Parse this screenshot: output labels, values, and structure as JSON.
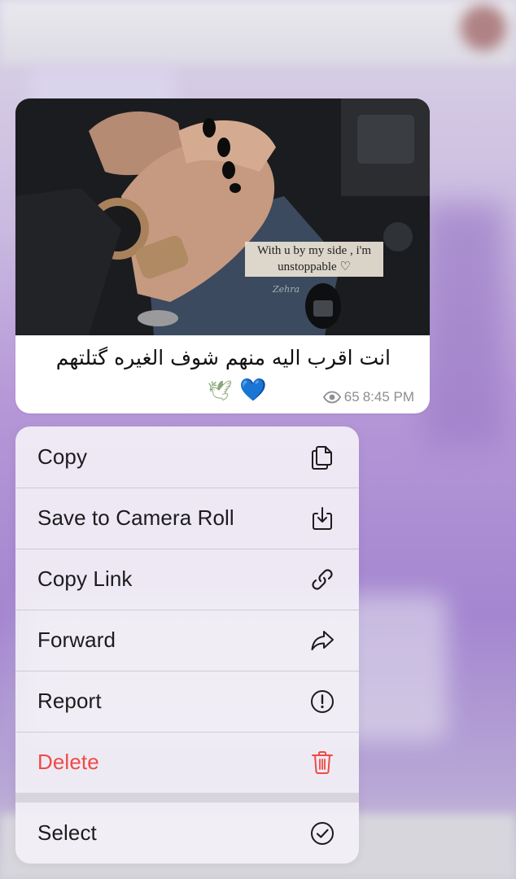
{
  "message": {
    "photo_quote_line1": "With u by my side , i'm",
    "photo_quote_line2": "unstoppable ♡",
    "photo_signature": "Zehra",
    "caption": "انت اقرب اليه منهم شوف الغيره گتلتهم",
    "emoji_heart": "💙",
    "emoji_dove": "🕊",
    "views": "65",
    "time": "8:45 PM"
  },
  "menu": {
    "items": [
      {
        "label": "Copy",
        "icon": "copy-icon"
      },
      {
        "label": "Save to Camera Roll",
        "icon": "save-download-icon"
      },
      {
        "label": "Copy Link",
        "icon": "link-icon"
      },
      {
        "label": "Forward",
        "icon": "forward-arrow-icon"
      },
      {
        "label": "Report",
        "icon": "report-exclamation-icon"
      },
      {
        "label": "Delete",
        "icon": "trash-icon",
        "color": "#ee4b45"
      },
      {
        "label": "Select",
        "icon": "checkmark-circle-icon"
      }
    ]
  },
  "colors": {
    "danger": "#ee4b45",
    "menu_text": "#1c1c1e",
    "meta_gray": "#8e8e93",
    "heart_blue": "#1e7de0"
  }
}
